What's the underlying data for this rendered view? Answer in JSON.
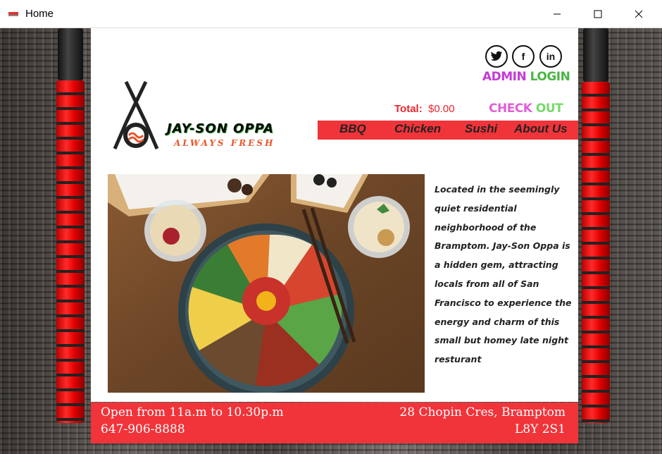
{
  "window": {
    "title": "Home"
  },
  "header": {
    "social": {
      "twitter": "twitter-icon",
      "facebook": "f",
      "linkedin": "in"
    },
    "admin_login_part1": "ADMIN",
    "admin_login_part2": "LOGIN",
    "total_label": "Total:",
    "total_value": "$0.00",
    "checkout_part1": "CHECK",
    "checkout_part2": "OUT"
  },
  "brand": {
    "name": "JAY-SON OPPA",
    "tagline": "ALWAYS FRESH"
  },
  "nav": {
    "items": [
      "BBQ",
      "Chicken",
      "Sushi",
      "About Us"
    ]
  },
  "main": {
    "description": "Located in the seemingly quiet residential neighborhood of the Bramptom. Jay-Son Oppa is a hidden gem, attracting locals from all of San Francisco to experience the energy and charm of this small but homey late night resturant"
  },
  "footer": {
    "hours": "Open from 11a.m to 10.30p.m",
    "phone": "647-906-8888",
    "address": "28 Chopin Cres, Bramptom",
    "postal": "L8Y 2S1"
  },
  "colors": {
    "accent": "#f0343a",
    "admin": "#c43ad6",
    "login": "#4bb543"
  }
}
